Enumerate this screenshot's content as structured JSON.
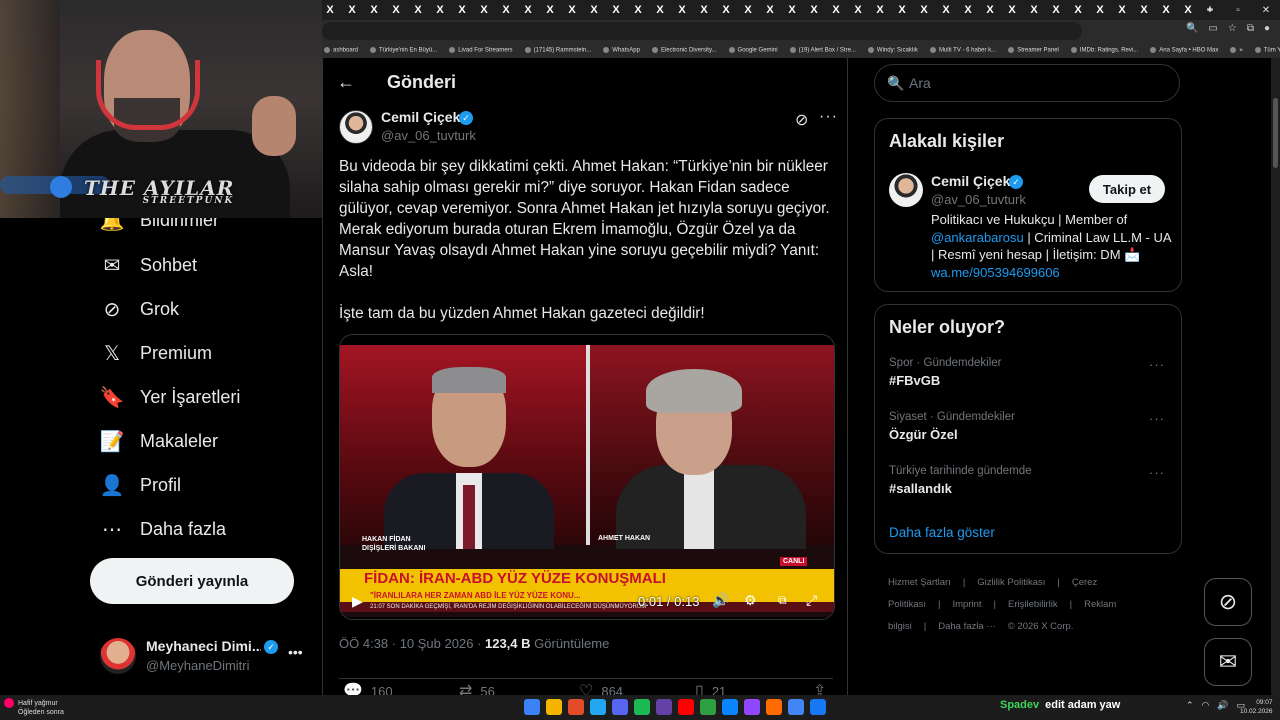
{
  "browser": {
    "tab_glyph": "X",
    "tab_count": 40,
    "bookmarks": [
      "ashboard",
      "Türkiye'nin En Büyü...",
      "Livad For Streamers",
      "(17145) Rammstein...",
      "WhatsApp",
      "Electronic Diversity...",
      "Google Gemini",
      "(19) Alert Box / Stre...",
      "Windy: Sıcaklık",
      "Multi TV - 6 haber k...",
      "Streamer Panel",
      "IMDb: Ratings, Revi...",
      "Ana Sayfa • HBO Max",
      "»",
      "Tüm Yer İşaretleri"
    ],
    "window_controls": [
      "–",
      "▫",
      "✕"
    ]
  },
  "webcam": {
    "brand": "THE AYILAR",
    "brand_sub": "STREETPUNK"
  },
  "nav": {
    "items": [
      {
        "label": "Bildirimler",
        "icon": "bell-icon",
        "glyph": "🔔"
      },
      {
        "label": "Sohbet",
        "icon": "mail-icon",
        "glyph": "✉"
      },
      {
        "label": "Grok",
        "icon": "grok-icon",
        "glyph": "⊘"
      },
      {
        "label": "Premium",
        "icon": "x-logo-icon",
        "glyph": "𝕏"
      },
      {
        "label": "Yer İşaretleri",
        "icon": "bookmark-icon",
        "glyph": "🔖"
      },
      {
        "label": "Makaleler",
        "icon": "article-icon",
        "glyph": "📝"
      },
      {
        "label": "Profil",
        "icon": "person-icon",
        "glyph": "👤"
      },
      {
        "label": "Daha fazla",
        "icon": "more-circle-icon",
        "glyph": "⋯"
      }
    ],
    "post_button": "Gönderi yayınla",
    "profile": {
      "name": "Meyhaneci Dimi...",
      "handle": "@MeyhaneDimitri"
    }
  },
  "post": {
    "header_title": "Gönderi",
    "author": {
      "name": "Cemil Çiçek",
      "handle": "@av_06_tuvturk"
    },
    "paragraphs": [
      "Bu videoda bir şey dikkatimi çekti. Ahmet Hakan: “Türkiye’nin bir nükleer silaha sahip olması gerekir mi?” diye soruyor. Hakan Fidan sadece gülüyor, cevap veremiyor. Sonra Ahmet Hakan jet hızıyla soruyu geçiyor. Merak ediyorum burada oturan Ekrem İmamoğlu, Özgür Özel ya da Mansur Yavaş olsaydı Ahmet Hakan yine soruyu geçebilir miydi? Yanıt: Asla!",
      "İşte tam da bu yüzden Ahmet Hakan gazeteci değildir!"
    ],
    "video": {
      "left_label_1": "HAKAN FİDAN",
      "left_label_2": "DIŞİŞLERİ BAKANI",
      "right_label": "AHMET HAKAN",
      "live_badge": "CANLI",
      "banner": "FİDAN: İRAN-ABD YÜZ YÜZE KONUŞMALI",
      "subbanner": "\"İRANLILARA HER ZAMAN ABD İLE YÜZ  YÜZE KONU...",
      "ticker": "21:07   SON DAKİKA   GEÇMİŞİ, İRAN'DA REJİM DEĞİŞİKLİĞİNİN OLABİLECEĞİNİ DÜŞÜNMÜYORUM",
      "time": "0:01 / 0:13"
    },
    "meta_time": "ÖÖ 4:38 · 10 Şub 2026 · ",
    "views_count": "123,4 B",
    "views_label": "Görüntüleme",
    "stats": {
      "replies": "160",
      "reposts": "56",
      "likes": "864",
      "bookmarks": "21"
    }
  },
  "right": {
    "search_placeholder": "Ara",
    "related_title": "Alakalı kişiler",
    "related": {
      "name": "Cemil Çiçek",
      "handle": "@av_06_tuvturk",
      "follow": "Takip et",
      "bio_1": "Politikacı ve Hukukçu | Member of ",
      "bio_link": "@ankarabarosu",
      "bio_2": " | Criminal Law LL.M - UA | Resmî yeni hesap | İletişim: DM 📩 ",
      "bio_url": "wa.me/905394699606"
    },
    "trends_title": "Neler oluyor?",
    "trends": [
      {
        "context": "Spor · Gündemdekiler",
        "topic": "#FBvGB"
      },
      {
        "context": "Siyaset · Gündemdekiler",
        "topic": "Özgür Özel"
      },
      {
        "context": "Türkiye tarihinde gündemde",
        "topic": "#sallandık"
      }
    ],
    "show_more": "Daha fazla göster",
    "footer": [
      "Hizmet Şartları",
      "|",
      "Gizlilik Politikası",
      "|",
      "Çerez Politikası",
      "|",
      "Imprint",
      "|",
      "Erişilebilirlik",
      "|",
      "Reklam bilgisi",
      "|",
      "Daha fazla ···",
      "© 2026 X Corp."
    ]
  },
  "taskbar": {
    "weather_1": "Hafif yağmur",
    "weather_2": "Öğleden sonra",
    "now_playing_app": "Spadev",
    "now_playing_title": "edit adam yaw",
    "clock_time": "09:07",
    "clock_date": "10.02.2026",
    "app_colors": [
      "#3b82f6",
      "#f4b400",
      "#e34c26",
      "#22a7f0",
      "#5865f2",
      "#1db954",
      "#6441a5",
      "#ff0000",
      "#2ea043",
      "#0a84ff",
      "#9146ff",
      "#ff6b00",
      "#4285f4",
      "#1877f2"
    ]
  },
  "colors": {
    "accent": "#1d9bf0",
    "bg": "#000000",
    "border": "#2f3336",
    "muted": "#71767b"
  }
}
